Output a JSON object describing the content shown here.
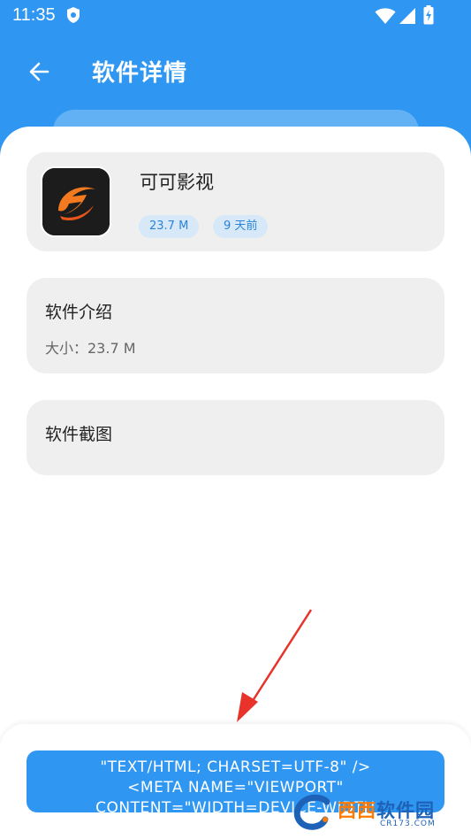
{
  "status_bar": {
    "time": "11:35"
  },
  "app_bar": {
    "title": "软件详情",
    "back_icon": "arrow-left-icon"
  },
  "app_card": {
    "name": "可可影视",
    "size_tag": "23.7 M",
    "date_tag": "9 天前",
    "icon": "app-logo-icon"
  },
  "intro_card": {
    "title": "软件介绍",
    "size_line": "大小：23.7 M"
  },
  "screenshots_card": {
    "title": "软件截图"
  },
  "download_button": {
    "line1": "\"TEXT/HTML; CHARSET=UTF-8\" />",
    "line2": "<META NAME=\"VIEWPORT\"",
    "line3": "CONTENT=\"WIDTH=DEVICE-WIDTH"
  },
  "watermark": {
    "text_part1": "西西",
    "text_part2": "软件园",
    "sub": "CR173.COM"
  },
  "colors": {
    "primary": "#2f97f2",
    "card_bg": "#efefef",
    "tag_bg": "#d7e8f8",
    "tag_text": "#2b84d8",
    "arrow": "#e8332a"
  }
}
